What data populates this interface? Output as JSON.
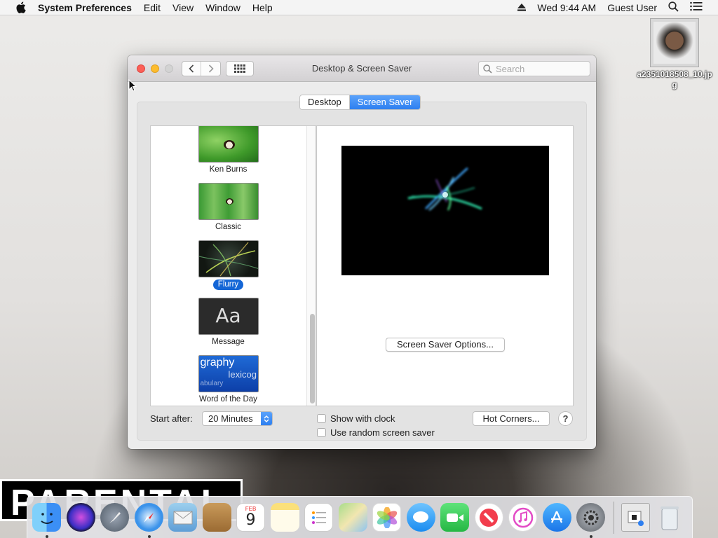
{
  "menubar": {
    "app_name": "System Preferences",
    "menus": [
      "Edit",
      "View",
      "Window",
      "Help"
    ],
    "clock": "Wed 9:44 AM",
    "user": "Guest User"
  },
  "desktop": {
    "file_name": "a2351018508_10.jpg",
    "background_sticker_text": "PARENTAL"
  },
  "window": {
    "title": "Desktop & Screen Saver",
    "search_placeholder": "Search",
    "tabs": [
      {
        "label": "Desktop",
        "selected": false
      },
      {
        "label": "Screen Saver",
        "selected": true
      }
    ]
  },
  "savers": {
    "items": [
      {
        "label": "Ken Burns",
        "selected": false
      },
      {
        "label": "Classic",
        "selected": false
      },
      {
        "label": "Flurry",
        "selected": true
      },
      {
        "label": "Message",
        "selected": false,
        "thumb_text": "Aa"
      },
      {
        "label": "Word of the Day",
        "selected": false,
        "thumb_text_1": "graphy",
        "thumb_text_2": "lexicog",
        "thumb_text_3": "abulary"
      }
    ]
  },
  "preview": {
    "options_button": "Screen Saver Options..."
  },
  "controls": {
    "start_after_label": "Start after:",
    "start_after_value": "20 Minutes",
    "show_with_clock": {
      "label": "Show with clock",
      "checked": false
    },
    "random_saver": {
      "label": "Use random screen saver",
      "checked": false
    },
    "hot_corners": "Hot Corners...",
    "help": "?"
  },
  "dock": {
    "apps": [
      "finder-icon",
      "siri-icon",
      "launchpad-icon",
      "safari-icon",
      "mail-icon",
      "contacts-icon",
      "calendar-icon",
      "notes-icon",
      "reminders-icon",
      "maps-icon",
      "photos-icon",
      "messages-icon",
      "facetime-icon",
      "news-icon",
      "itunes-icon",
      "app-store-icon",
      "system-preferences-icon"
    ],
    "calendar_month": "FEB",
    "calendar_day": "9"
  },
  "colors": {
    "accent": "#2d7ff0",
    "selection": "#1466d6",
    "close": "#fc5f57",
    "minimize": "#fdbc2e"
  }
}
